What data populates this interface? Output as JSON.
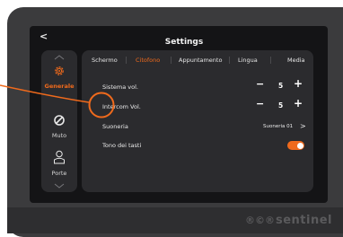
{
  "header": {
    "title": "Settings",
    "back_glyph": "<"
  },
  "sidebar": {
    "items": [
      {
        "label": "Generale",
        "icon": "gear-icon"
      },
      {
        "label": "Muto",
        "icon": "mute-icon"
      },
      {
        "label": "Porte",
        "icon": "door-icon"
      }
    ]
  },
  "tabs": [
    {
      "label": "Schermo"
    },
    {
      "label": "Citofono"
    },
    {
      "label": "Appuntamento"
    },
    {
      "label": "Lingua"
    },
    {
      "label": "Media"
    }
  ],
  "settings": {
    "system_volume": {
      "label": "Sistema vol.",
      "value": "5",
      "minus": "−",
      "plus": "+"
    },
    "intercom_volume": {
      "label": "Intercom Vol.",
      "value": "5",
      "minus": "−",
      "plus": "+"
    },
    "ringtone": {
      "label": "Suoneria",
      "value": "Suoneria 01",
      "arrow": ">"
    },
    "key_tone": {
      "label": "Tono dei tasti",
      "enabled": true
    }
  },
  "brand": {
    "mark": "®©®",
    "name": "sentinel"
  },
  "colors": {
    "accent": "#f06a1c",
    "panel": "#2b2b2e",
    "screen": "#141416",
    "bezel": "#3b3b3d"
  }
}
